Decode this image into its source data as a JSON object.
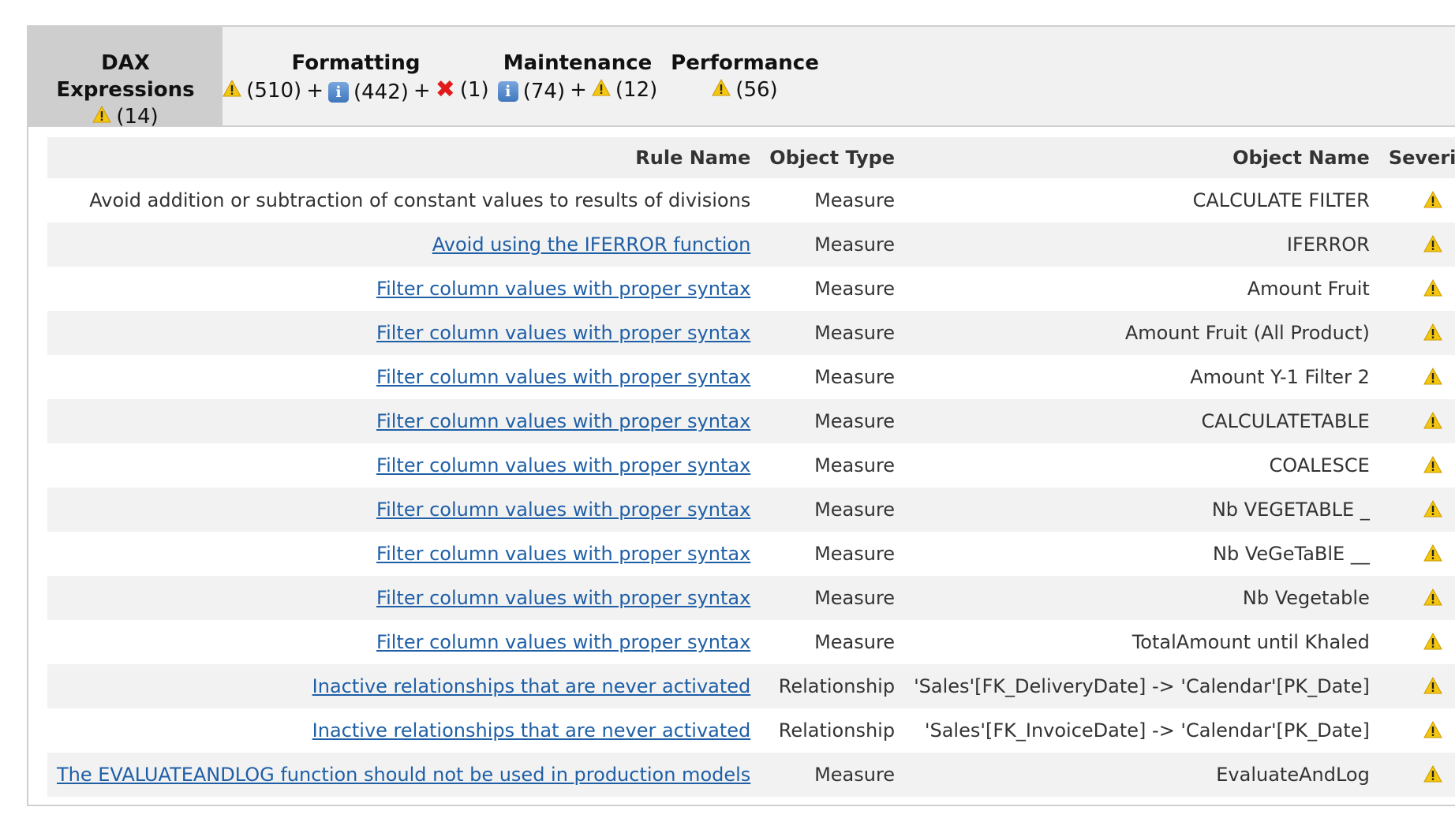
{
  "tabs": [
    {
      "title": "DAX Expressions",
      "active": true,
      "badges": [
        {
          "icon": "warning-icon",
          "count": "(14)"
        }
      ]
    },
    {
      "title": "Formatting",
      "active": false,
      "badges": [
        {
          "icon": "warning-icon",
          "count": "(510)"
        },
        {
          "icon": "info-icon",
          "count": "(442)"
        },
        {
          "icon": "error-icon",
          "count": "(1)"
        }
      ]
    },
    {
      "title": "Maintenance",
      "active": false,
      "badges": [
        {
          "icon": "info-icon",
          "count": "(74)"
        },
        {
          "icon": "warning-icon",
          "count": "(12)"
        }
      ]
    },
    {
      "title": "Performance",
      "active": false,
      "badges": [
        {
          "icon": "warning-icon",
          "count": "(56)"
        }
      ]
    }
  ],
  "table": {
    "headers": {
      "rule_name": "Rule Name",
      "object_type": "Object Type",
      "object_name": "Object Name",
      "severity": "Severity"
    },
    "rows": [
      {
        "rule": "Avoid addition or subtraction of constant values to results of divisions",
        "link": false,
        "type": "Measure",
        "name": "CALCULATE FILTER",
        "severity": "warning-icon"
      },
      {
        "rule": "Avoid using the IFERROR function",
        "link": true,
        "type": "Measure",
        "name": "IFERROR",
        "severity": "warning-icon"
      },
      {
        "rule": "Filter column values with proper syntax",
        "link": true,
        "type": "Measure",
        "name": "Amount Fruit",
        "severity": "warning-icon"
      },
      {
        "rule": "Filter column values with proper syntax",
        "link": true,
        "type": "Measure",
        "name": "Amount Fruit (All Product)",
        "severity": "warning-icon"
      },
      {
        "rule": "Filter column values with proper syntax",
        "link": true,
        "type": "Measure",
        "name": "Amount Y-1 Filter 2",
        "severity": "warning-icon"
      },
      {
        "rule": "Filter column values with proper syntax",
        "link": true,
        "type": "Measure",
        "name": "CALCULATETABLE",
        "severity": "warning-icon"
      },
      {
        "rule": "Filter column values with proper syntax",
        "link": true,
        "type": "Measure",
        "name": "COALESCE",
        "severity": "warning-icon"
      },
      {
        "rule": "Filter column values with proper syntax",
        "link": true,
        "type": "Measure",
        "name": "Nb VEGETABLE _",
        "severity": "warning-icon"
      },
      {
        "rule": "Filter column values with proper syntax",
        "link": true,
        "type": "Measure",
        "name": "Nb VeGeTaBlE __",
        "severity": "warning-icon"
      },
      {
        "rule": "Filter column values with proper syntax",
        "link": true,
        "type": "Measure",
        "name": "Nb Vegetable",
        "severity": "warning-icon"
      },
      {
        "rule": "Filter column values with proper syntax",
        "link": true,
        "type": "Measure",
        "name": "TotalAmount until Khaled",
        "severity": "warning-icon"
      },
      {
        "rule": "Inactive relationships that are never activated",
        "link": true,
        "type": "Relationship",
        "name": "'Sales'[FK_DeliveryDate] -> 'Calendar'[PK_Date]",
        "severity": "warning-icon"
      },
      {
        "rule": "Inactive relationships that are never activated",
        "link": true,
        "type": "Relationship",
        "name": "'Sales'[FK_InvoiceDate] -> 'Calendar'[PK_Date]",
        "severity": "warning-icon"
      },
      {
        "rule": "The EVALUATEANDLOG function should not be used in production models",
        "link": true,
        "type": "Measure",
        "name": "EvaluateAndLog",
        "severity": "warning-icon"
      }
    ]
  }
}
